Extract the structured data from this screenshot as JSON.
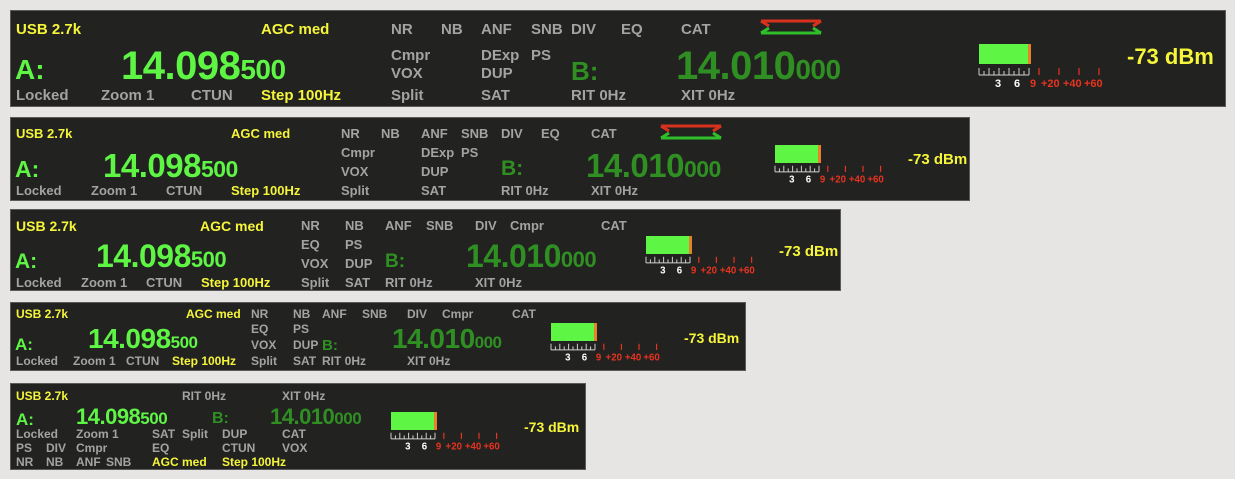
{
  "radio": {
    "mode": "USB 2.7k",
    "agc": "AGC med",
    "nr": "NR",
    "nb": "NB",
    "anf": "ANF",
    "snb": "SNB",
    "div": "DIV",
    "eq": "EQ",
    "cat": "CAT",
    "cmpr": "Cmpr",
    "dexp": "DExp",
    "ps": "PS",
    "vox": "VOX",
    "dup": "DUP",
    "split": "Split",
    "sat": "SAT",
    "locked": "Locked",
    "zoom": "Zoom 1",
    "ctun": "CTUN",
    "step": "Step 100Hz",
    "rit": "RIT 0Hz",
    "xit": "XIT 0Hz",
    "vfo_a_label": "A:",
    "vfo_a_main": "14.098",
    "vfo_a_sub": "500",
    "vfo_b_label": "B:",
    "vfo_b_main": "14.010",
    "vfo_b_sub": "000",
    "signal": "-73 dBm",
    "meter_level_fraction": 0.95,
    "scale_white": [
      "3",
      "6"
    ],
    "scale_red": [
      "9",
      "+20",
      "+40",
      "+60"
    ]
  },
  "colors": {
    "background": "#222221",
    "label_gray": "#a3a3a3",
    "active_yellow": "#f5f53a",
    "vfo_a_green": "#5ef545",
    "vfo_b_green": "#2f8f22",
    "scale_red": "#e8331f",
    "split_red": "#d8321f"
  }
}
